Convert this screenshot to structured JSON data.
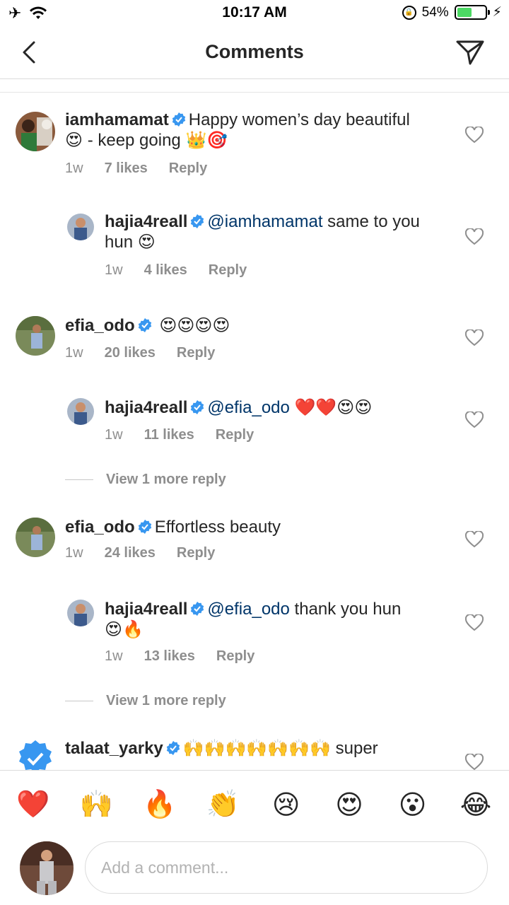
{
  "status_bar": {
    "time": "10:17 AM",
    "battery": "54%",
    "battery_level": 0.54
  },
  "header": {
    "title": "Comments"
  },
  "comments": [
    {
      "user": "iamhamamat",
      "text_parts": [
        {
          "t": "Happy women’s day beautiful"
        },
        {
          "t": "😍 - keep going 👑🎯"
        }
      ],
      "time": "1w",
      "likes": "7 likes",
      "reply": "Reply"
    },
    {
      "user": "hajia4reall",
      "mention": "@iamhamamat",
      "text": " same to you",
      "text2": "hun 😍",
      "time": "1w",
      "likes": "4 likes",
      "reply": "Reply"
    },
    {
      "user": "efia_odo",
      "text": "😍😍😍😍",
      "time": "1w",
      "likes": "20 likes",
      "reply": "Reply"
    },
    {
      "user": "hajia4reall",
      "mention": "@efia_odo",
      "text": " ❤️❤️😍😍",
      "time": "1w",
      "likes": "11 likes",
      "reply": "Reply"
    },
    {
      "user": "efia_odo",
      "text": "Effortless beauty",
      "time": "1w",
      "likes": "24 likes",
      "reply": "Reply"
    },
    {
      "user": "hajia4reall",
      "mention": "@efia_odo",
      "text": " thank you hun",
      "text2": "😍🔥",
      "time": "1w",
      "likes": "13 likes",
      "reply": "Reply"
    },
    {
      "user": "talaat_yarky",
      "text": "🙌🙌🙌🙌🙌🙌🙌 super"
    }
  ],
  "view_more": [
    "View 1 more reply",
    "View 1 more reply"
  ],
  "quick_emojis": [
    "❤️",
    "🙌",
    "🔥",
    "👏",
    "😢",
    "😍",
    "😮",
    "😂"
  ],
  "input": {
    "placeholder": "Add a comment..."
  }
}
